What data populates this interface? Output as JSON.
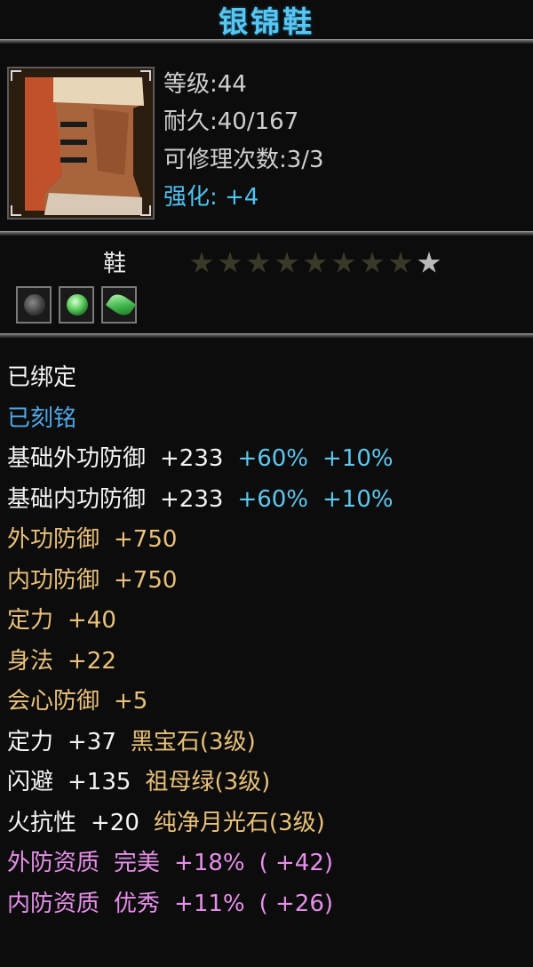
{
  "title": "银锦鞋",
  "item": {
    "icon": "silver-brocade-boot-icon",
    "level": "等级:44",
    "durability": "耐久:40/167",
    "repair_count": "可修理次数:3/3",
    "enhance": "强化: +4",
    "type": "鞋",
    "stars": {
      "total": 9,
      "lit": 1
    },
    "sockets": [
      "gray-stone-gem-icon",
      "green-jade-gem-icon",
      "green-leaf-gem-icon"
    ]
  },
  "lines": [
    {
      "parts": [
        {
          "text": "已绑定",
          "color": "white"
        }
      ]
    },
    {
      "parts": [
        {
          "text": "已刻铭",
          "color": "blue"
        }
      ]
    },
    {
      "parts": [
        {
          "text": "基础外功防御",
          "color": "white"
        },
        {
          "text": "+233",
          "color": "white"
        },
        {
          "text": "+60%",
          "color": "cyan"
        },
        {
          "text": "+10%",
          "color": "cyan"
        }
      ]
    },
    {
      "parts": [
        {
          "text": "基础内功防御",
          "color": "white"
        },
        {
          "text": "+233",
          "color": "white"
        },
        {
          "text": "+60%",
          "color": "cyan"
        },
        {
          "text": "+10%",
          "color": "cyan"
        }
      ]
    },
    {
      "parts": [
        {
          "text": "外功防御",
          "color": "gold"
        },
        {
          "text": "+750",
          "color": "gold"
        }
      ]
    },
    {
      "parts": [
        {
          "text": "内功防御",
          "color": "gold"
        },
        {
          "text": "+750",
          "color": "gold"
        }
      ]
    },
    {
      "parts": [
        {
          "text": "定力",
          "color": "gold"
        },
        {
          "text": "+40",
          "color": "gold"
        }
      ]
    },
    {
      "parts": [
        {
          "text": "身法",
          "color": "gold"
        },
        {
          "text": "+22",
          "color": "gold"
        }
      ]
    },
    {
      "parts": [
        {
          "text": "会心防御",
          "color": "gold"
        },
        {
          "text": "+5",
          "color": "gold"
        }
      ]
    },
    {
      "parts": [
        {
          "text": "定力",
          "color": "white"
        },
        {
          "text": "+37",
          "color": "white"
        },
        {
          "text": "黑宝石(3级)",
          "color": "gold"
        }
      ]
    },
    {
      "parts": [
        {
          "text": "闪避",
          "color": "white"
        },
        {
          "text": "+135",
          "color": "white"
        },
        {
          "text": "祖母绿(3级)",
          "color": "gold"
        }
      ]
    },
    {
      "parts": [
        {
          "text": "火抗性",
          "color": "white"
        },
        {
          "text": "+20",
          "color": "white"
        },
        {
          "text": "纯净月光石(3级)",
          "color": "gold"
        }
      ]
    },
    {
      "parts": [
        {
          "text": "外防资质",
          "color": "pink"
        },
        {
          "text": "完美",
          "color": "pink"
        },
        {
          "text": "+18%",
          "color": "pink"
        },
        {
          "text": "( +42)",
          "color": "pink"
        }
      ]
    },
    {
      "parts": [
        {
          "text": "内防资质",
          "color": "pink"
        },
        {
          "text": "优秀",
          "color": "pink"
        },
        {
          "text": "+11%",
          "color": "pink"
        },
        {
          "text": "( +26)",
          "color": "pink"
        }
      ]
    }
  ],
  "colors": {
    "white": "#f4f4f4",
    "blue": "#4fa9ea",
    "cyan": "#5ec7ef",
    "gold": "#e9c17a",
    "pink": "#e58fe8",
    "title": "#59c6f2"
  }
}
